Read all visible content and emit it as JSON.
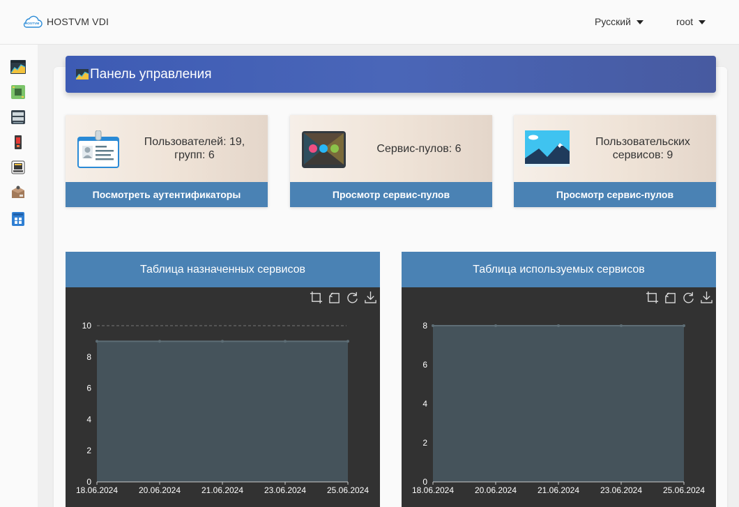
{
  "app": {
    "name": "HOSTVM VDI",
    "logo_text": "HOSTVM"
  },
  "topbar": {
    "language": "Русский",
    "user": "root"
  },
  "sidebar": {
    "items": [
      {
        "icon": "dashboard-icon"
      },
      {
        "icon": "chip-board-icon"
      },
      {
        "icon": "server-icon"
      },
      {
        "icon": "battery-device-icon"
      },
      {
        "icon": "network-port-icon"
      },
      {
        "icon": "package-icon"
      },
      {
        "icon": "apps-grid-icon"
      }
    ]
  },
  "page": {
    "title": "Панель управления"
  },
  "cards": [
    {
      "text_line1": "Пользователей: 19,",
      "text_line2": "групп: 6",
      "button": "Посмотреть аутентификаторы",
      "icon": "id-badge-icon"
    },
    {
      "text_line1": "Сервис-пулов: 6",
      "text_line2": "",
      "button": "Просмотр сервис-пулов",
      "icon": "service-pool-monitor-icon"
    },
    {
      "text_line1": "Пользовательских",
      "text_line2": "сервисов: 9",
      "button": "Просмотр сервис-пулов",
      "icon": "desktop-landscape-icon"
    }
  ],
  "chart_data": [
    {
      "type": "area",
      "title": "Таблица назначенных сервисов",
      "categories": [
        "18.06.2024",
        "20.06.2024",
        "21.06.2024",
        "23.06.2024",
        "25.06.2024"
      ],
      "values": [
        9,
        9,
        9,
        9,
        9
      ],
      "ylim": [
        0,
        10
      ],
      "yticks": [
        0,
        2,
        4,
        6,
        8,
        10
      ],
      "grid": true,
      "colors": {
        "area": "#45535b",
        "line": "#5e6e76",
        "grid": "#777777"
      }
    },
    {
      "type": "area",
      "title": "Таблица используемых сервисов",
      "categories": [
        "18.06.2024",
        "20.06.2024",
        "21.06.2024",
        "23.06.2024",
        "25.06.2024"
      ],
      "values": [
        8,
        8,
        8,
        8,
        8
      ],
      "ylim": [
        0,
        8
      ],
      "yticks": [
        0,
        2,
        4,
        6,
        8
      ],
      "grid": true,
      "colors": {
        "area": "#45535b",
        "line": "#5e6e76",
        "grid": "#777777"
      }
    }
  ],
  "chart_tools": [
    "crop-zoom-icon",
    "zoom-reset-icon",
    "refresh-icon",
    "download-icon"
  ],
  "colors": {
    "header": "#4a66b8",
    "card_button": "#4a82b4",
    "chart_bg": "#323232"
  }
}
